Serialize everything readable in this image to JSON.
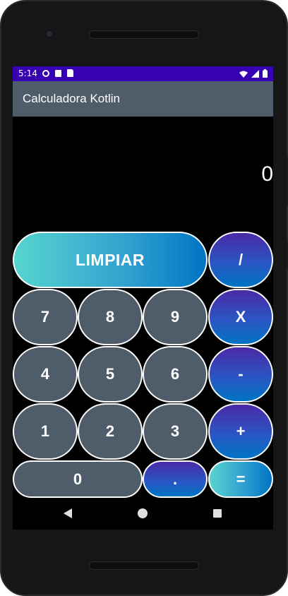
{
  "status_bar": {
    "time": "5:14",
    "icons_left": [
      "gear-icon",
      "a-icon",
      "sd-card-icon"
    ],
    "icons_right": [
      "wifi-icon",
      "signal-icon",
      "battery-icon"
    ],
    "color": "#3700b3"
  },
  "app_bar": {
    "title": "Calculadora Kotlin",
    "color": "#4f5d6a"
  },
  "display": {
    "value": "0"
  },
  "keypad": {
    "clear": "LIMPIAR",
    "divide": "/",
    "multiply": "X",
    "subtract": "-",
    "add": "+",
    "equals": "=",
    "decimal": ".",
    "digits": {
      "d0": "0",
      "d1": "1",
      "d2": "2",
      "d3": "3",
      "d4": "4",
      "d5": "5",
      "d6": "6",
      "d7": "7",
      "d8": "8",
      "d9": "9"
    }
  },
  "colors": {
    "number_button": "#4f5d6a",
    "operator_gradient_start": "#4a2aa6",
    "operator_gradient_end": "#0074c4",
    "clear_gradient_start": "#57d4cf"
  },
  "navigation_bar": {
    "icons": [
      "back-icon",
      "home-icon",
      "recents-icon"
    ]
  }
}
